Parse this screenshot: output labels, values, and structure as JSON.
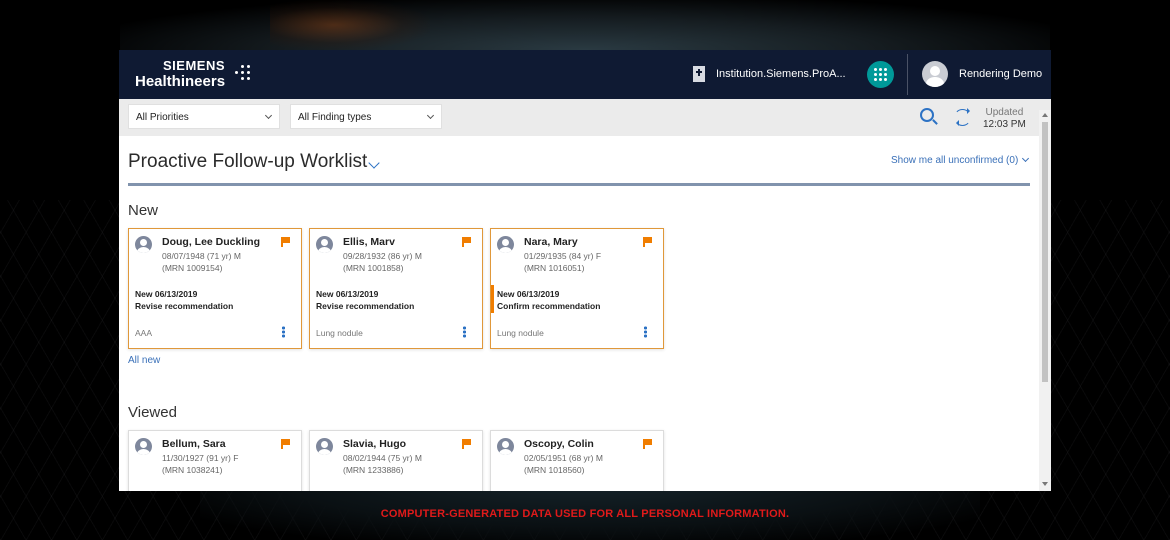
{
  "header": {
    "logo_line1": "SIEMENS",
    "logo_line2": "Healthineers",
    "institution": "Institution.Siemens.ProA...",
    "user_name": "Rendering Demo"
  },
  "toolbar": {
    "priority_filter": "All Priorities",
    "finding_filter": "All Finding types",
    "updated_label": "Updated",
    "updated_time": "12:03 PM"
  },
  "worklist": {
    "title": "Proactive Follow-up Worklist",
    "show_unconfirmed": "Show me all unconfirmed (0)",
    "new_section": "New",
    "all_new_link": "All new",
    "viewed_section": "Viewed"
  },
  "new_cards": [
    {
      "name": "Doug, Lee Duckling",
      "dob": "08/07/1948 (71 yr) M",
      "mrn": "(MRN 1009154)",
      "status": "New 06/13/2019",
      "task": "Revise recommendation",
      "finding": "AAA"
    },
    {
      "name": "Ellis, Marv",
      "dob": "09/28/1932 (86 yr) M",
      "mrn": "(MRN 1001858)",
      "status": "New 06/13/2019",
      "task": "Revise recommendation",
      "finding": "Lung nodule"
    },
    {
      "name": "Nara, Mary",
      "dob": "01/29/1935 (84 yr) F",
      "mrn": "(MRN 1016051)",
      "status": "New 06/13/2019",
      "task": "Confirm recommendation",
      "finding": "Lung nodule"
    }
  ],
  "viewed_cards": [
    {
      "name": "Bellum, Sara",
      "dob": "11/30/1927 (91 yr) F",
      "mrn": "(MRN 1038241)"
    },
    {
      "name": "Slavia, Hugo",
      "dob": "08/02/1944 (75 yr) M",
      "mrn": "(MRN 1233886)"
    },
    {
      "name": "Oscopy, Colin",
      "dob": "02/05/1951 (68 yr) M",
      "mrn": "(MRN 1018560)"
    }
  ],
  "disclaimer": "COMPUTER-GENERATED DATA USED FOR ALL PERSONAL INFORMATION.",
  "colors": {
    "header_bg": "#0f1a33",
    "accent_teal": "#009999",
    "flag_orange": "#f07d00",
    "link_blue": "#3a70b8"
  }
}
